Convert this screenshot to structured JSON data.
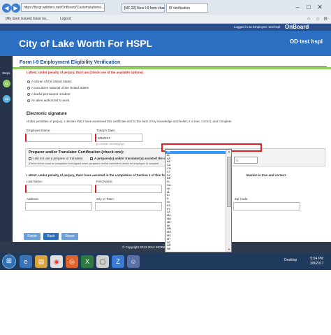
{
  "browser": {
    "url": "https://lhcgr.wdtrlers.net/OnBoard/Customizations/...",
    "tabs": [
      "[NF-22] New I-9 form changes ...",
      "I9 Verification"
    ],
    "bookmarks": [
      "[My open issues] Issue na...",
      "Logout"
    ]
  },
  "app": {
    "logged_in_label": "Logged in as Employee: test hspl",
    "logo_text": "OnBoard",
    "org_title": "City of Lake Worth For HSPL",
    "user_name": "OD test hspl"
  },
  "sidebar": {
    "steps_label": "Steps",
    "steps": [
      "01",
      "02"
    ]
  },
  "form": {
    "section_title": "Form I-9 Employment Eligibility Verification",
    "attest_prompt": "I attest, under penalty of perjury, that I am (check one of the available options)",
    "status_options": [
      "A citizen of the United States",
      "A noncitizen national of the United States",
      "A lawful permanent resident",
      "An alien authorized to work"
    ],
    "signature_heading": "Electronic signature",
    "signature_text": "Under penalties of perjury, I declare that I have examined this certificate and to the best of my knowledge and belief, it is true, correct, and complete",
    "employee_name_label": "Employee Name:",
    "todays_date_label": "Today's Date:",
    "todays_date_value": "3/8/2017",
    "date_hint": "(In format: mm/dd/yyyy)",
    "preparer_heading": "Preparer and/or Translator Certification (check one):",
    "not_preparer_label": "I did not use a preparer or translator.",
    "used_preparer_label": "A preparer(s) and/or translator(s) assisted the e",
    "preparer_note": "(Fields below must be completed and signed when preparers and/or translators assist an employee in completi",
    "preparer_attest": "I attest, under penalty of perjury, that I have assisted in the completion of Section 1 of this form",
    "preparer_attest_end": "rmation is true and correct.",
    "last_name_label": "Last Name:",
    "first_name_label": "First Name:",
    "address_label": "Address:",
    "city_label": "City or Town:",
    "zip_label": "Zip Code:",
    "mini_select_value": "1",
    "buttons": {
      "finish": "Finish",
      "back": "Back",
      "reset": "Reset"
    },
    "footer": "© Copyright 2013-2014 WORKTI"
  },
  "state_dropdown": {
    "selected": "AK",
    "items": [
      "AK",
      "AL",
      "AR",
      "AZ",
      "CA",
      "CO",
      "CT",
      "DC",
      "DE",
      "FL",
      "GA",
      "HI",
      "IA",
      "ID",
      "IL",
      "IN",
      "KS",
      "KY",
      "LA",
      "MA",
      "MD",
      "ME",
      "MI",
      "MN",
      "MO",
      "MS",
      "MT",
      "NC",
      "ND",
      "NE"
    ]
  },
  "taskbar": {
    "desktop_label": "Desktop",
    "time": "5:04 PM",
    "date": "3/8/2017"
  },
  "colors": {
    "brand_blue": "#2a6fc2",
    "accent_green": "#8fcf5d",
    "required_red": "#d02020",
    "highlight_frame": "#e02020"
  }
}
